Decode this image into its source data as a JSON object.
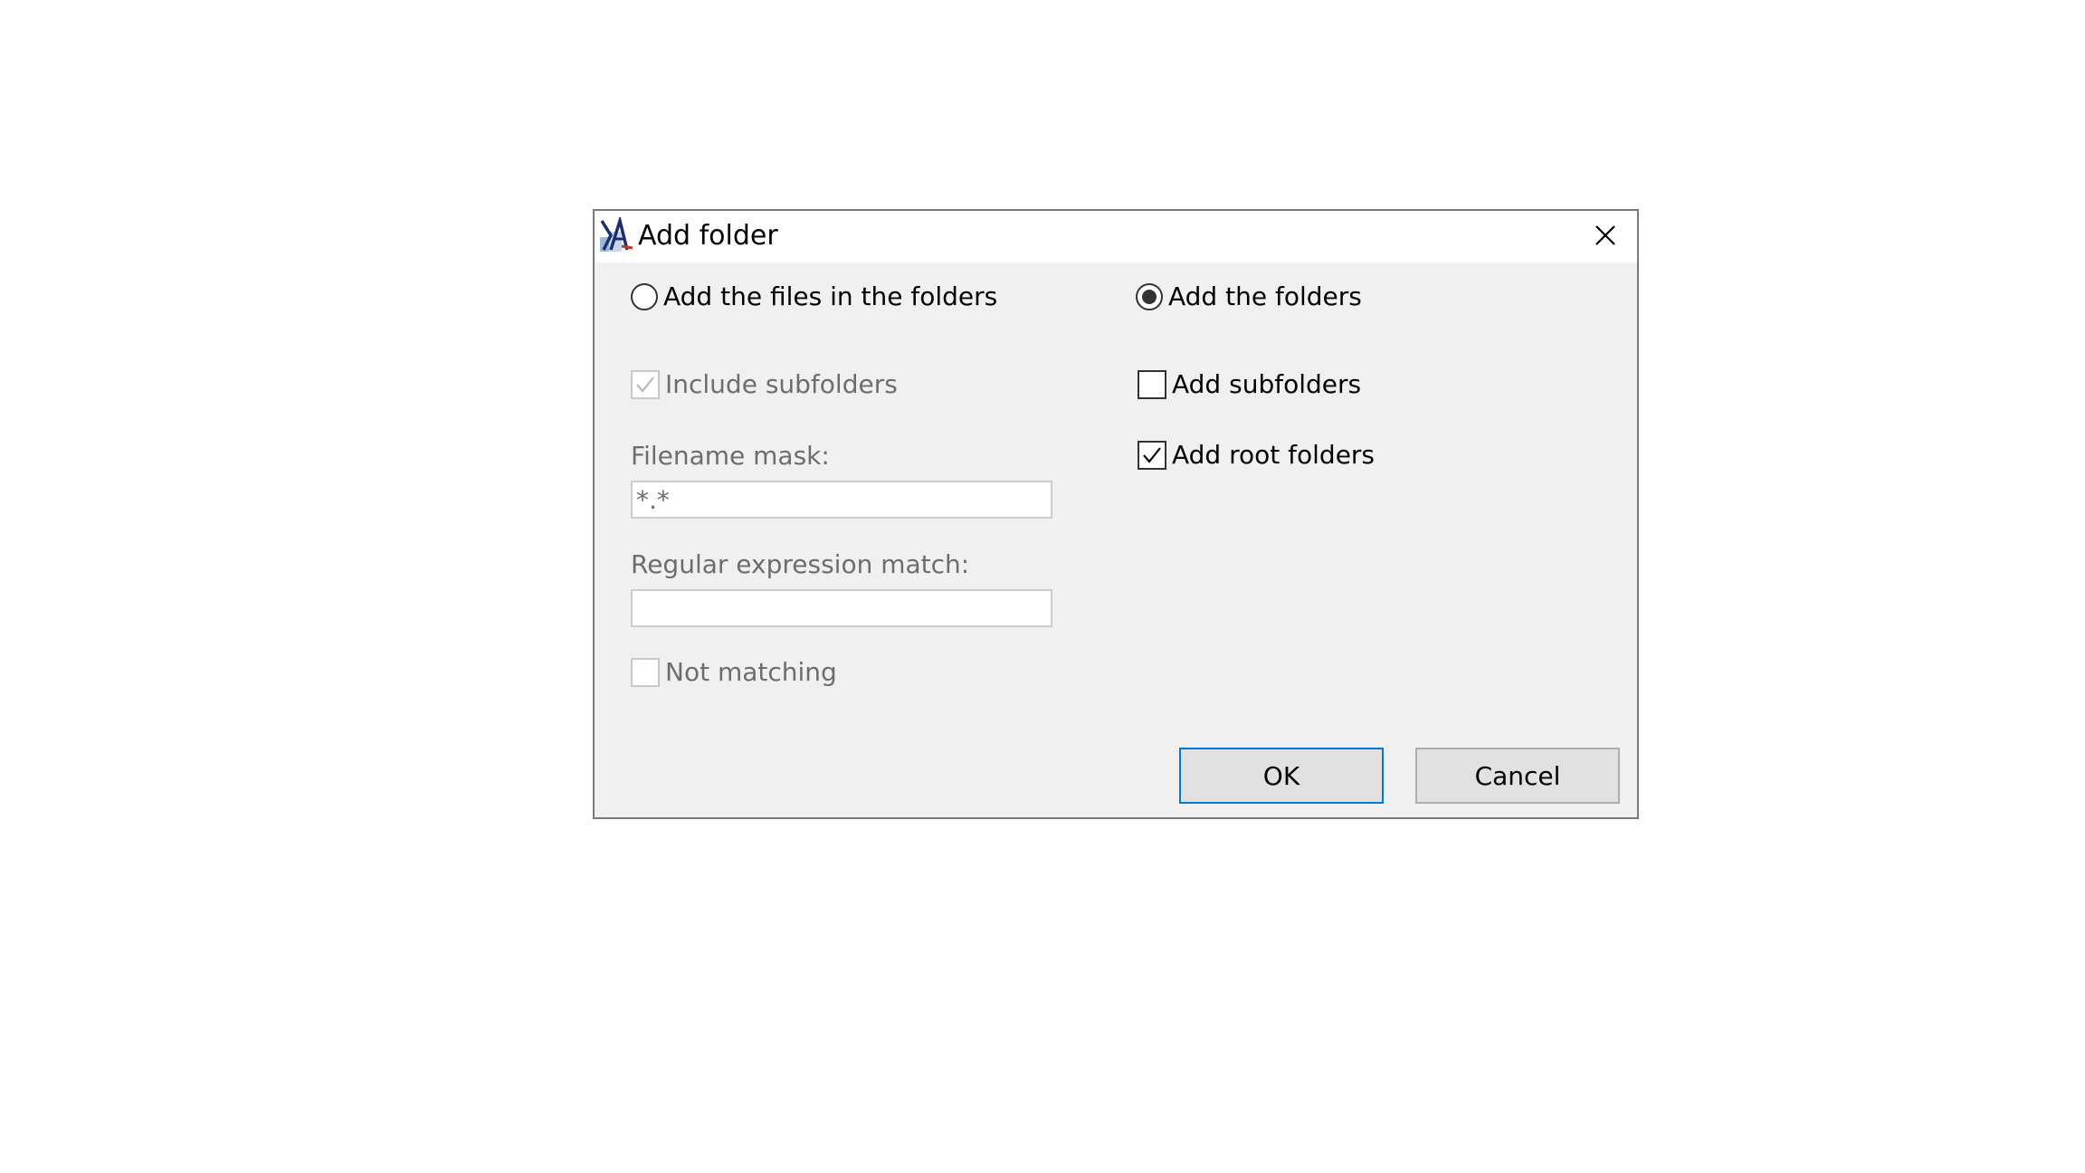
{
  "dialog": {
    "title": "Add folder",
    "icons": {
      "app": "app-logo-icon",
      "close": "close-icon"
    }
  },
  "mode": {
    "files_label": "Add the files in the folders",
    "files_selected": false,
    "folders_label": "Add the folders",
    "folders_selected": true
  },
  "files_options": {
    "include_subfolders_label": "Include subfolders",
    "include_subfolders_checked": true,
    "include_subfolders_enabled": false,
    "filename_mask_label": "Filename mask:",
    "filename_mask_value": "*.*",
    "regex_label": "Regular expression match:",
    "regex_value": "",
    "not_matching_label": "Not matching",
    "not_matching_checked": false
  },
  "folder_options": {
    "add_subfolders_label": "Add subfolders",
    "add_subfolders_checked": false,
    "add_root_folders_label": "Add root folders",
    "add_root_folders_checked": true
  },
  "buttons": {
    "ok_label": "OK",
    "cancel_label": "Cancel"
  },
  "colors": {
    "accent": "#0078d7",
    "dialog_background": "#f0f0f0",
    "disabled_text": "#6d6d6d"
  }
}
